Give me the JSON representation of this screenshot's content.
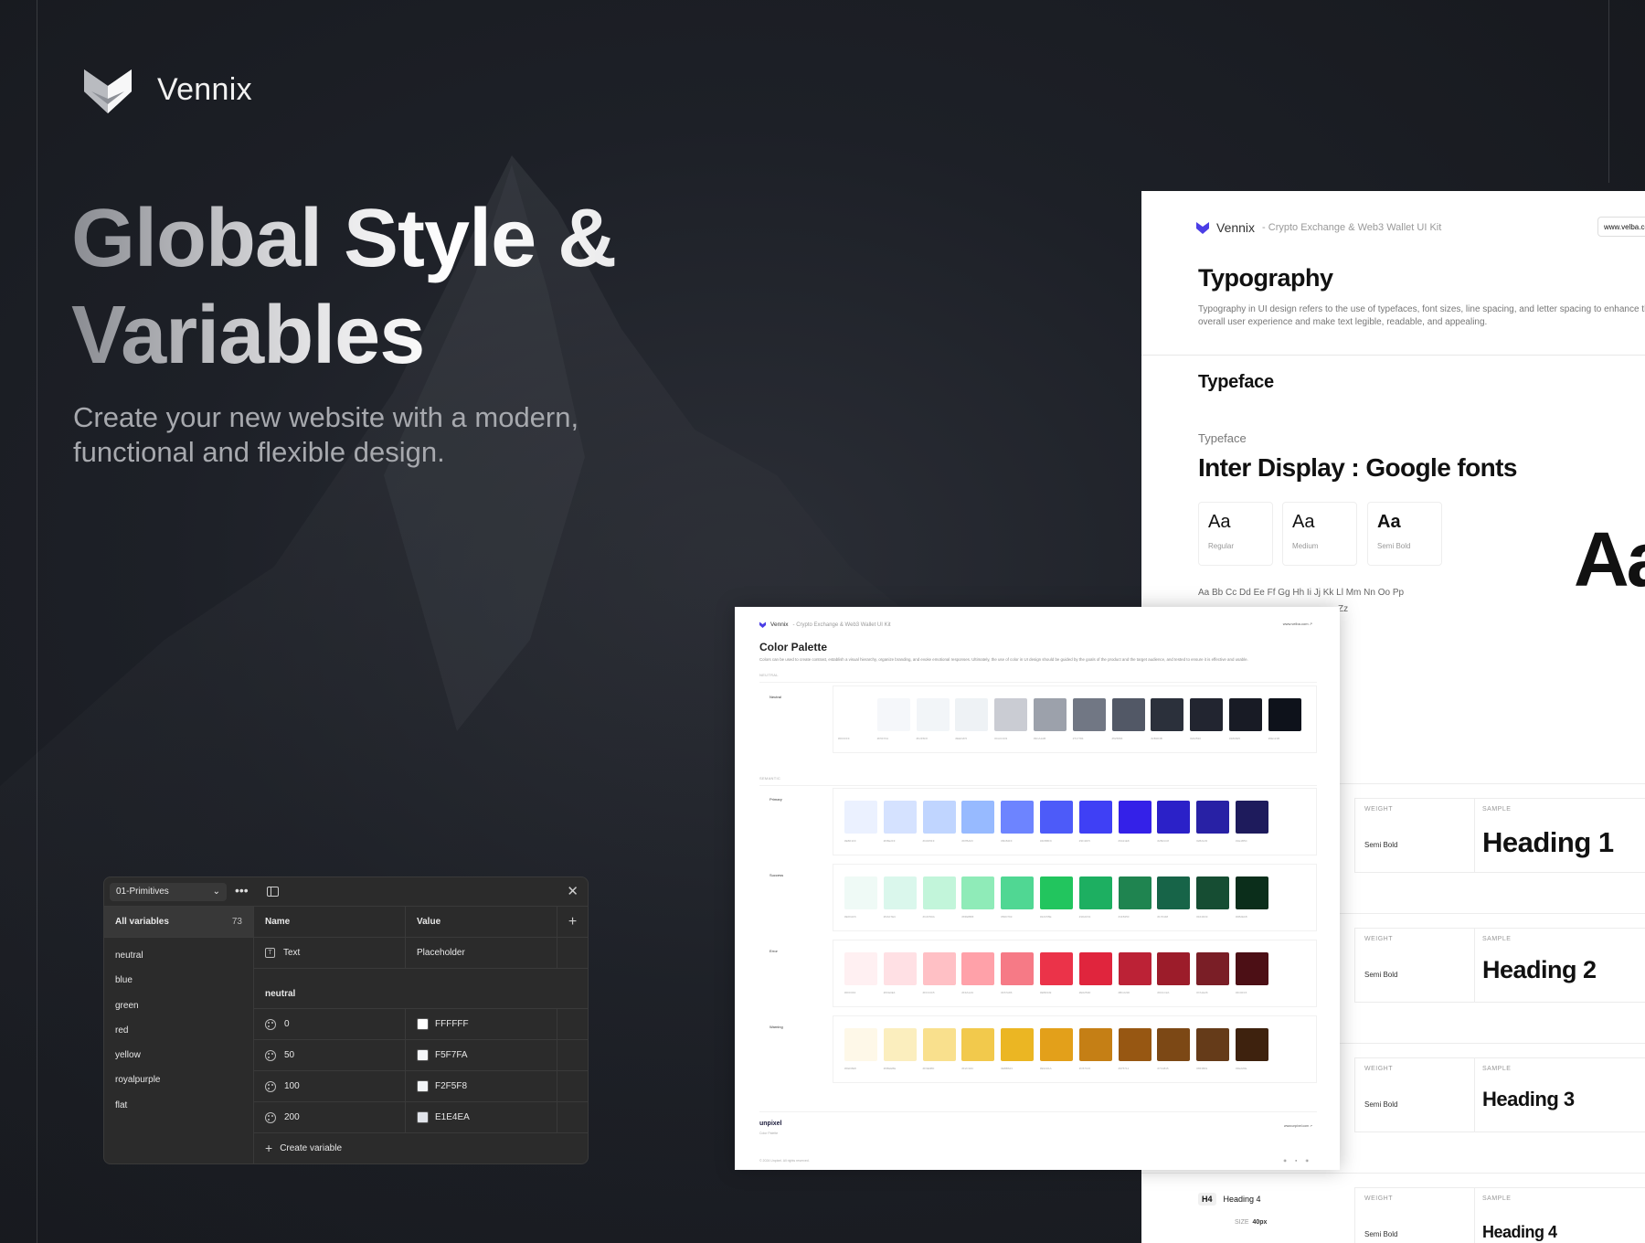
{
  "brand": {
    "name": "Vennix"
  },
  "hero": {
    "title_line1": "Global Style &",
    "title_line2": "Variables",
    "subtitle_line1": "Create your new website with a modern,",
    "subtitle_line2": "functional and flexible design."
  },
  "variables_panel": {
    "collection": "01-Primitives",
    "all_variables_label": "All variables",
    "all_variables_count": "73",
    "groups": [
      "neutral",
      "blue",
      "green",
      "red",
      "yellow",
      "royalpurple",
      "flat"
    ],
    "columns": {
      "name": "Name",
      "value": "Value"
    },
    "text_row": {
      "name": "Text",
      "value": "Placeholder"
    },
    "section": "neutral",
    "rows": [
      {
        "name": "0",
        "value": "FFFFFF",
        "color": "#FFFFFF"
      },
      {
        "name": "50",
        "value": "F5F7FA",
        "color": "#F5F7FA"
      },
      {
        "name": "100",
        "value": "F2F5F8",
        "color": "#F2F5F8"
      },
      {
        "name": "200",
        "value": "E1E4EA",
        "color": "#E1E4EA"
      }
    ],
    "create_label": "Create variable"
  },
  "typography_card": {
    "brand": "Vennix",
    "kit": "- Crypto Exchange & Web3 Wallet UI Kit",
    "url": "www.velba.com",
    "title": "Typography",
    "description": "Typography in UI design refers to the use of typefaces, font sizes, line spacing, and letter spacing to enhance the overall user experience and make text legible, readable, and appealing.",
    "typeface_heading": "Typeface",
    "typeface_label": "Typeface",
    "typeface_name": "Inter Display : Google fonts",
    "weights": [
      {
        "sample": "Aa",
        "name": "Regular"
      },
      {
        "sample": "Aa",
        "name": "Medium"
      },
      {
        "sample": "Aa",
        "name": "Semi Bold"
      }
    ],
    "alphabet": "Aa Bb Cc Dd Ee Ff Gg Hh Ii Jj Kk Ll Mm Nn Oo Pp",
    "alphabet_tail": "Zz",
    "big_sample": "Aa",
    "weight_label": "WEIGHT",
    "sample_label": "SAMPLE",
    "headings": [
      {
        "weight": "Semi Bold",
        "sample": "Heading 1"
      },
      {
        "weight": "Semi Bold",
        "sample": "Heading 2"
      },
      {
        "weight": "Semi Bold",
        "sample": "Heading 3"
      },
      {
        "weight": "Semi Bold",
        "sample": "Heading 4"
      }
    ],
    "h4_tag": "H4",
    "h4_label": "Heading 4",
    "size_label": "SIZE",
    "size_value": "40px"
  },
  "color_card": {
    "brand": "Vennix",
    "kit": "- Crypto Exchange & Web3 Wallet UI Kit",
    "url": "www.velba.com ↗",
    "title": "Color Palette",
    "description": "Colors can be used to create contrast, establish a visual hierarchy, organize branding, and evoke emotional responses. Ultimately, the use of color in UI design should be guided by the goals of the product and the target audience, and tested to ensure it is effective and usable.",
    "section_neutral": "NEUTRAL",
    "section_semantic": "SEMANTIC",
    "groups": [
      {
        "name": "Neutral",
        "colors": [
          "#FFFFFF",
          "#F5F7FA",
          "#F2F5F8",
          "#EEF2F5",
          "#CACCD3",
          "#9CA1AB",
          "#717784",
          "#525866",
          "#2B303B",
          "#222530",
          "#181B25",
          "#0E121B"
        ]
      },
      {
        "name": "Primary",
        "colors": [
          "#EBF1FF",
          "#D5E2FF",
          "#C0D5FF",
          "#97BAFF",
          "#6D84FF",
          "#4D5BF9",
          "#3F40F5",
          "#3421E8",
          "#2B21C8",
          "#2821A5",
          "#1E1B5C"
        ]
      },
      {
        "name": "Success",
        "colors": [
          "#EFFAF6",
          "#DAF7EC",
          "#C2F5DA",
          "#8FEBB8",
          "#50D793",
          "#22C55E",
          "#1DAF61",
          "#1F8450",
          "#176448",
          "#164D33",
          "#0B2E1B"
        ]
      },
      {
        "name": "Error",
        "colors": [
          "#FFF0F2",
          "#FFE0E4",
          "#FFC0C5",
          "#FFA1A9",
          "#F67A86",
          "#EB3349",
          "#E0253D",
          "#BC2236",
          "#9C1C2A",
          "#7A1E26",
          "#4C0F15"
        ]
      },
      {
        "name": "Warning",
        "colors": [
          "#FEF8E8",
          "#FBEEBE",
          "#F9E08D",
          "#F2C94C",
          "#EBB623",
          "#E3A01A",
          "#C57F15",
          "#975712",
          "#7C4815",
          "#653B19",
          "#3E220E"
        ]
      }
    ],
    "footer_brand": "unpixel",
    "footer_sub": "Color Palette",
    "footer_url": "www.unpixel.com ↗",
    "copyright": "© 2024 Unpixel. All rights reserved.",
    "social": "◉ ● ◉"
  }
}
